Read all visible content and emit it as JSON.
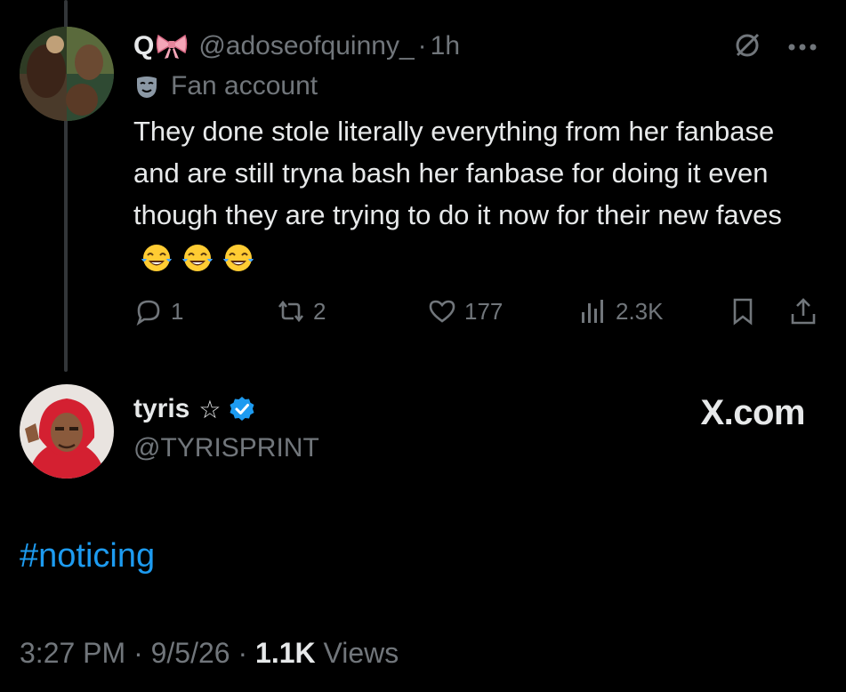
{
  "reply": {
    "display_name": "Q",
    "handle": "@adoseofquinny_",
    "separator": "·",
    "time": "1h",
    "label": "Fan account",
    "text": "They done stole literally everything from her fanbase and are still tryna bash her fanbase for doing it even though they are trying to do it now for their new faves",
    "emojis": [
      "face-with-tears-of-joy",
      "face-with-tears-of-joy",
      "face-with-tears-of-joy"
    ],
    "actions": {
      "replies": "1",
      "reposts": "2",
      "likes": "177",
      "views": "2.3K"
    }
  },
  "post": {
    "display_name": "tyris",
    "name_suffix": "☆",
    "handle": "@TYRISPRINT",
    "watermark": "X.com",
    "text": "#noticing",
    "timestamp_time": "3:27 PM",
    "sep1": "·",
    "timestamp_date": "9/5/26",
    "sep2": "·",
    "views_count": "1.1K",
    "views_label": "Views"
  },
  "colors": {
    "background": "#000000",
    "text_primary": "#e7e9ea",
    "text_secondary": "#71767b",
    "link": "#1d9bf0",
    "verified": "#1d9bf0"
  },
  "icons": [
    "bow-icon",
    "grok-icon",
    "more-icon",
    "mask-icon",
    "reply-icon",
    "repost-icon",
    "like-icon",
    "views-icon",
    "bookmark-icon",
    "share-icon",
    "verified-badge-icon",
    "star-icon"
  ]
}
